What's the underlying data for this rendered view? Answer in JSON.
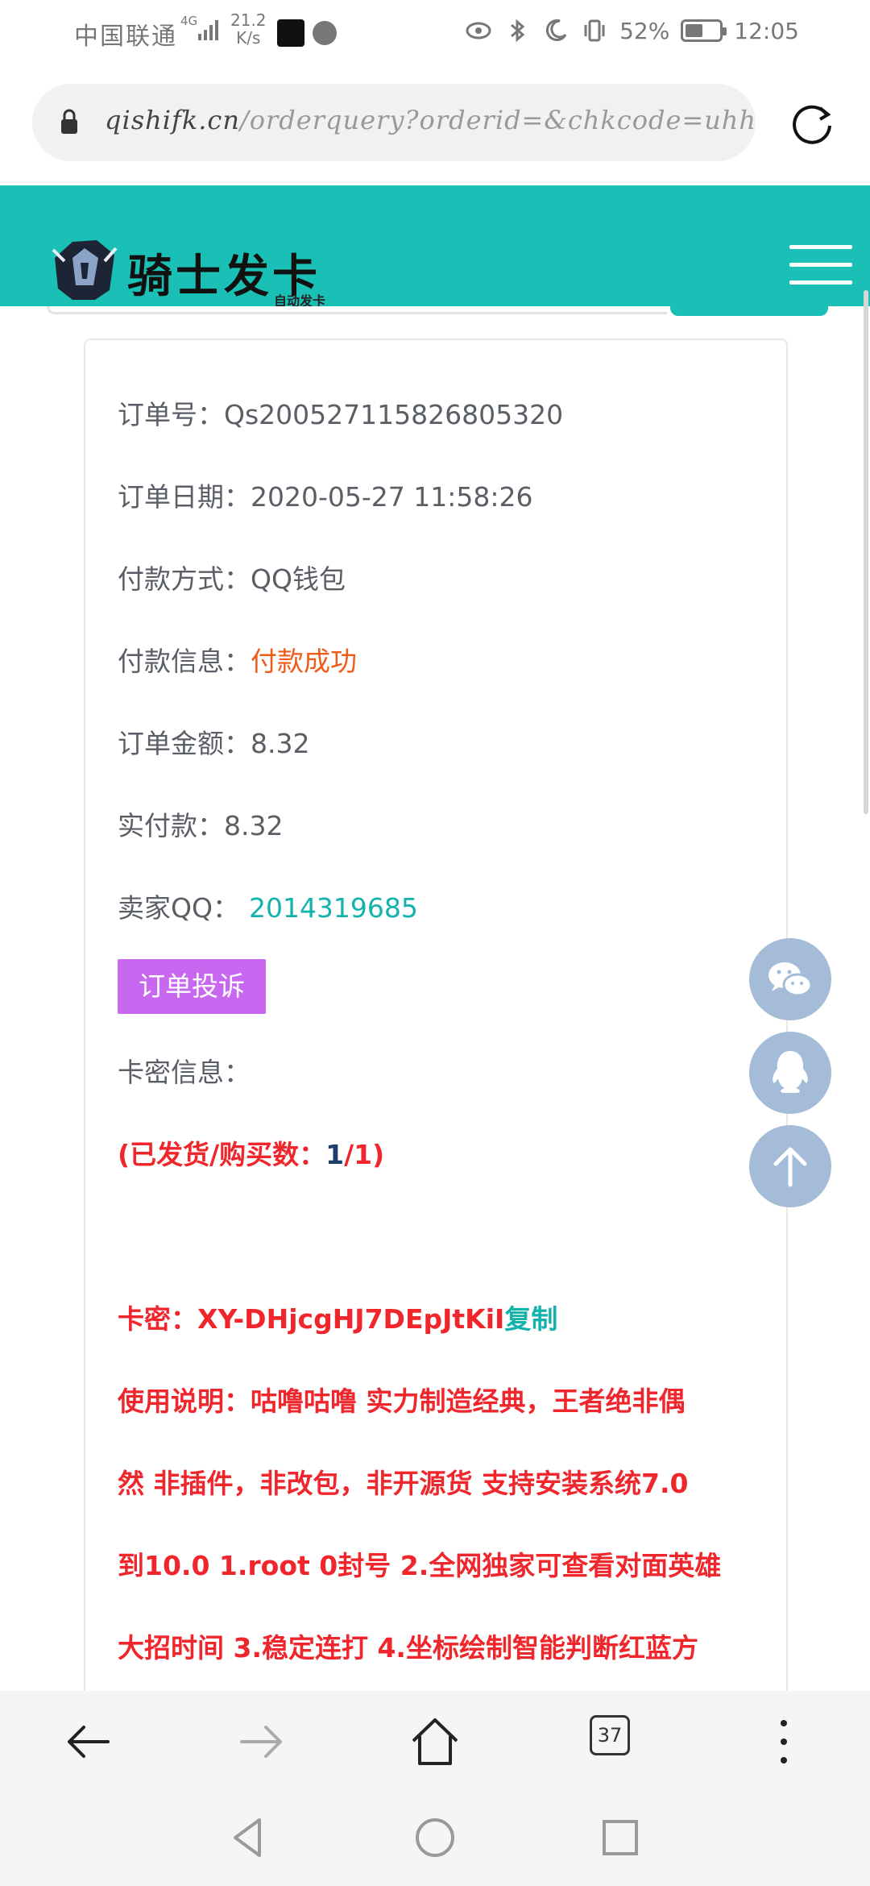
{
  "status_bar": {
    "carrier": "中国联通",
    "network": "4G",
    "speed_value": "21.2",
    "speed_unit": "K/s",
    "battery_percent": "52%",
    "battery_level": 0.52,
    "time": "12:05"
  },
  "browser": {
    "url_domain": "qishifk.cn",
    "url_path": "/orderquery?orderid=&chkcode=uhhk&quer",
    "tab_count": "37"
  },
  "site": {
    "logo_text": "骑士发卡",
    "logo_subtitle": "自动发卡",
    "brand_color": "#1abfb5"
  },
  "order": {
    "order_no_label": "订单号：",
    "order_no": "Qs200527115826805320",
    "date_label": "订单日期：",
    "date": "2020-05-27 11:58:26",
    "pay_method_label": "付款方式：",
    "pay_method": "QQ钱包",
    "pay_info_label": "付款信息：",
    "pay_info": "付款成功",
    "amount_label": "订单金额：",
    "amount": "8.32",
    "paid_label": "实付款：",
    "paid": "8.32",
    "seller_qq_label": "卖家QQ：",
    "seller_qq": "2014319685",
    "complain_button": "订单投诉",
    "card_info_label": "卡密信息：",
    "shipped_prefix": "(已发货/购买数：",
    "shipped_count": "1",
    "shipped_suffix": "/1)",
    "card_key_label": "卡密：",
    "card_key": "XY-DHjcgHJ7DEpJtKiI",
    "copy_label": "复制",
    "usage_lines": [
      "使用说明：咕噜咕噜 实力制造经典，王者绝非偶",
      "然 非插件，非改包，非开源货 支持安装系统7.0",
      "到10.0 1.root 0封号 2.全网独家可查看对面英雄",
      "大招时间 3.稳定连打 4.坐标绘制智能判断红蓝方"
    ]
  },
  "floating": {
    "wechat": "wechat-icon",
    "qq": "qq-icon",
    "top": "arrow-up-icon"
  }
}
